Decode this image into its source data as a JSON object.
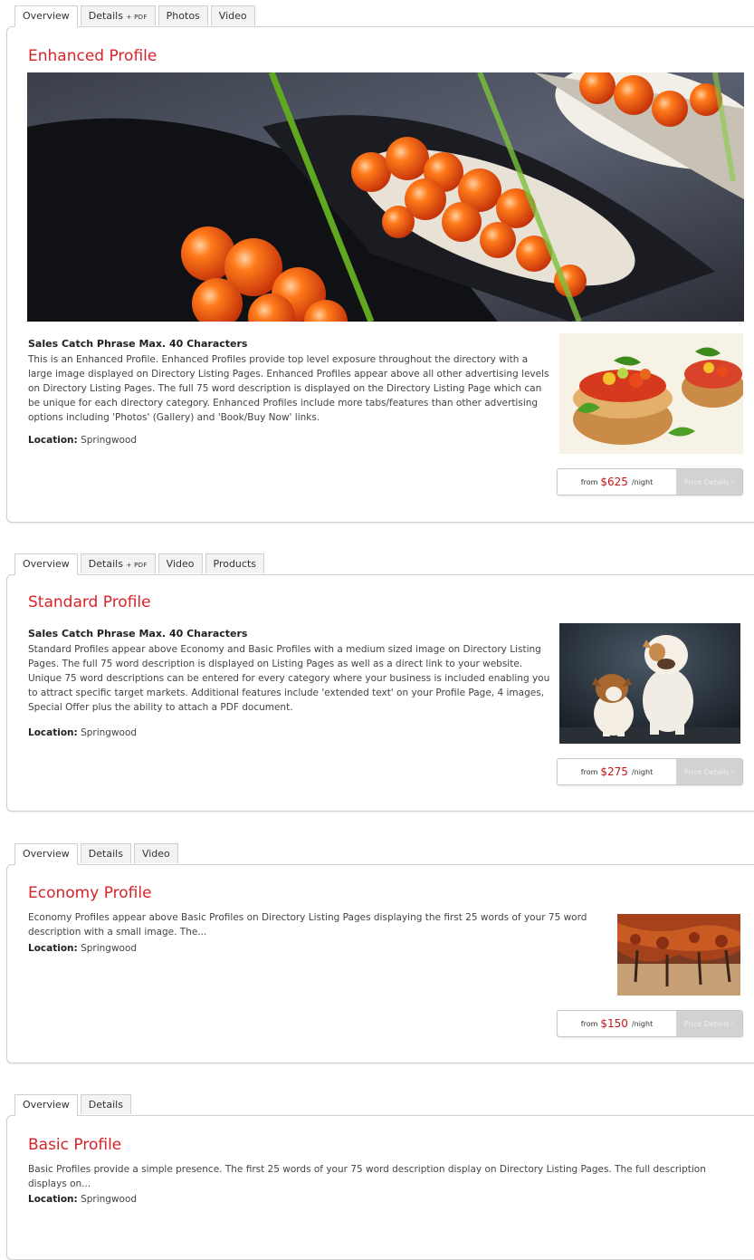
{
  "listings": [
    {
      "tabs": [
        {
          "label": "Overview"
        },
        {
          "label": "Details",
          "suffix": "+ PDF"
        },
        {
          "label": "Photos"
        },
        {
          "label": "Video"
        }
      ],
      "title": "Enhanced Profile",
      "catch_phrase": "Sales Catch Phrase Max. 40 Characters",
      "description": "This is an Enhanced Profile. Enhanced Profiles provide top level exposure throughout the directory with a large image displayed on Directory Listing Pages. Enhanced Profiles appear above all other advertising levels on Directory Listing Pages. The full 75 word description is displayed on the Directory Listing Page which can be unique for each directory category. Enhanced Profiles include more tabs/features than other advertising options including 'Photos' (Gallery) and 'Book/Buy Now' links.",
      "location_label": "Location:",
      "location": "Springwood",
      "price": {
        "from": "from",
        "amount": "$625",
        "unit": "/night",
        "button": "Price Details ›"
      }
    },
    {
      "tabs": [
        {
          "label": "Overview"
        },
        {
          "label": "Details",
          "suffix": "+ PDF"
        },
        {
          "label": "Video"
        },
        {
          "label": "Products"
        }
      ],
      "title": "Standard Profile",
      "catch_phrase": "Sales Catch Phrase Max. 40 Characters",
      "description": "Standard Profiles appear above Economy and Basic Profiles with a medium sized image on Directory Listing Pages. The full 75 word description is displayed on Listing Pages as well as a direct link to your website. Unique 75 word descriptions can be entered for every category where your business is included enabling you to attract specific target markets. Additional features include 'extended text' on your Profile Page, 4 images, Special Offer plus the ability to attach a PDF document.",
      "location_label": "Location:",
      "location": "Springwood",
      "price": {
        "from": "from",
        "amount": "$275",
        "unit": "/night",
        "button": "Price Details ›"
      }
    },
    {
      "tabs": [
        {
          "label": "Overview"
        },
        {
          "label": "Details"
        },
        {
          "label": "Video"
        }
      ],
      "title": "Economy Profile",
      "description": "Economy Profiles appear above Basic Profiles on Directory Listing Pages displaying the first 25 words of your 75 word description with a small image. The...",
      "location_label": "Location:",
      "location": "Springwood",
      "price": {
        "from": "from",
        "amount": "$150",
        "unit": "/night",
        "button": "Price Details ›"
      }
    },
    {
      "tabs": [
        {
          "label": "Overview"
        },
        {
          "label": "Details"
        }
      ],
      "title": "Basic Profile",
      "description": "Basic Profiles provide a simple presence. The first 25 words of your 75 word description display on Directory Listing Pages. The full description displays on...",
      "location_label": "Location:",
      "location": "Springwood"
    }
  ],
  "colors": {
    "title": "#d8232a",
    "price": "#c4161c",
    "button": "#d2d2d2",
    "border": "#d0d0d0"
  }
}
